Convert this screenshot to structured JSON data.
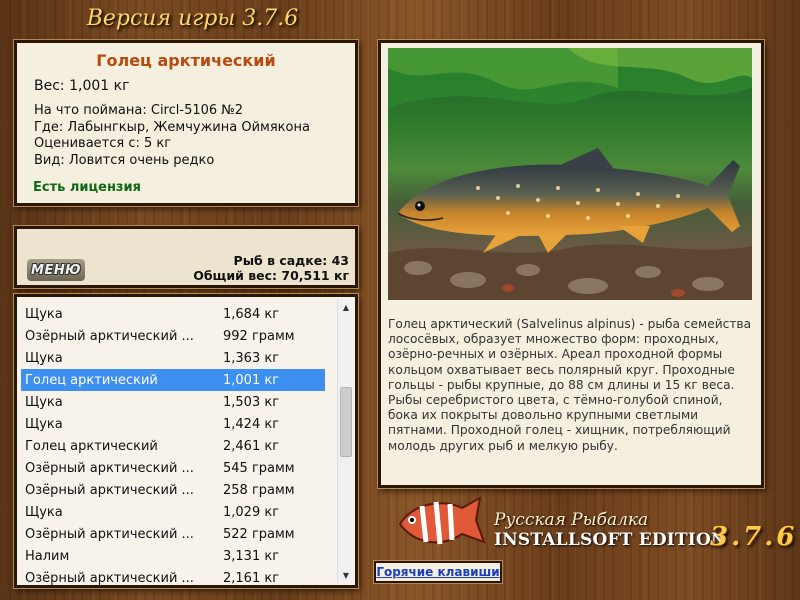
{
  "header": {
    "title": "Версия игры 3.7.6"
  },
  "catch": {
    "fish_name": "Голец арктический",
    "weight": "Вес: 1,001 кг",
    "bait": "На что поймана: Circl-5106 №2",
    "location": "Где: Лабынгкыр, Жемчужина Оймякона",
    "price": "Оценивается с: 5 кг",
    "rarity": "Вид: Ловится очень редко",
    "license": "Есть лицензия"
  },
  "stats": {
    "menu_label": "МЕНЮ",
    "fish_count": "Рыб в садке: 43",
    "total_weight": "Общий вес: 70,511 кг"
  },
  "list": {
    "items": [
      {
        "name": "Щука",
        "weight": "1,684 кг"
      },
      {
        "name": "Озёрный арктический ...",
        "weight": "992 грамм"
      },
      {
        "name": "Щука",
        "weight": "1,363 кг"
      },
      {
        "name": "Голец арктический",
        "weight": "1,001 кг"
      },
      {
        "name": "Щука",
        "weight": "1,503 кг"
      },
      {
        "name": "Щука",
        "weight": "1,424 кг"
      },
      {
        "name": "Голец арктический",
        "weight": "2,461 кг"
      },
      {
        "name": "Озёрный арктический ...",
        "weight": "545 грамм"
      },
      {
        "name": "Озёрный арктический ...",
        "weight": "258 грамм"
      },
      {
        "name": "Щука",
        "weight": "1,029 кг"
      },
      {
        "name": "Озёрный арктический ...",
        "weight": "522 грамм"
      },
      {
        "name": "Налим",
        "weight": "3,131 кг"
      },
      {
        "name": "Озёрный арктический ...",
        "weight": "2,161 кг"
      }
    ],
    "selected_index": 3
  },
  "description": "Голец арктический (Salvelinus alpinus) - рыба семейства лососёвых, образует множество форм: проходных, озёрно-речных и озёрных. Ареал проходной формы кольцом охватывает весь полярный круг. Проходные гольцы - рыбы крупные, до 88 см длины и 15 кг веса. Рыбы серебристого цвета, с тёмно-голубой спиной, бока их покрыты довольно крупными светлыми пятнами. Проходной голец - хищник, потребляющий молодь других рыб и мелкую рыбу.",
  "branding": {
    "line1": "Русская Рыбалка",
    "line2": "INSTALLSOFT EDITION",
    "version": "3.7.6"
  },
  "hotkeys_label": "Горячие клавиши",
  "colors": {
    "selection": "#3d8ff0",
    "fish_name": "#b84a0e",
    "license": "#0f6b12",
    "link": "#1a3fbf"
  }
}
